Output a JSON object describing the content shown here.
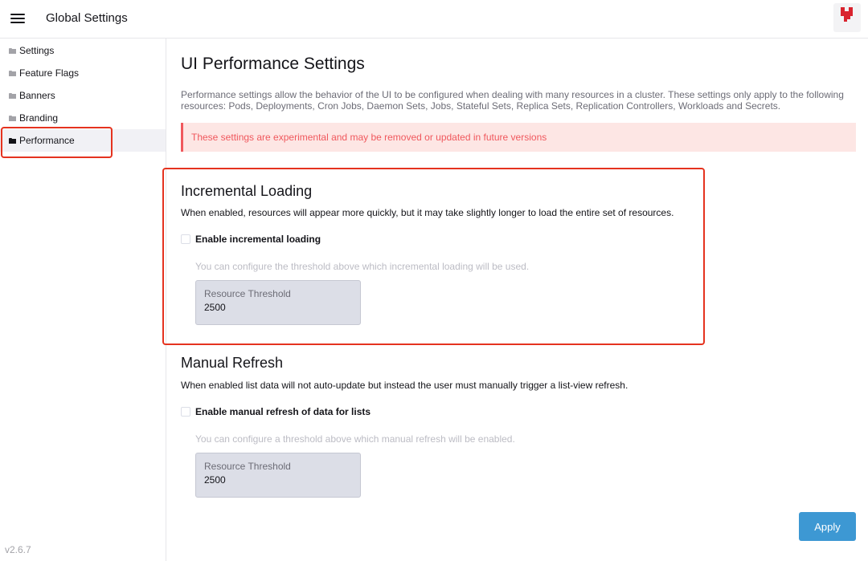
{
  "header": {
    "title": "Global Settings",
    "menu_icon": "hamburger-icon",
    "avatar_icon": "brand-logo-icon"
  },
  "sidebar": {
    "items": [
      {
        "label": "Settings",
        "icon": "folder-icon",
        "active": false
      },
      {
        "label": "Feature Flags",
        "icon": "folder-icon",
        "active": false
      },
      {
        "label": "Banners",
        "icon": "folder-icon",
        "active": false
      },
      {
        "label": "Branding",
        "icon": "folder-icon",
        "active": false
      },
      {
        "label": "Performance",
        "icon": "folder-icon",
        "active": true
      }
    ],
    "version": "v2.6.7"
  },
  "main": {
    "title": "UI Performance Settings",
    "description": "Performance settings allow the behavior of the UI to be configured when dealing with many resources in a cluster. These settings only apply to the following resources: Pods, Deployments, Cron Jobs, Daemon Sets, Jobs, Stateful Sets, Replica Sets, Replication Controllers, Workloads and Secrets.",
    "warning": "These settings are experimental and may be removed or updated in future versions",
    "incremental": {
      "title": "Incremental Loading",
      "description": "When enabled, resources will appear more quickly, but it may take slightly longer to load the entire set of resources.",
      "checkbox_label": "Enable incremental loading",
      "checked": false,
      "hint": "You can configure the threshold above which incremental loading will be used.",
      "threshold_label": "Resource Threshold",
      "threshold_value": "2500"
    },
    "manual": {
      "title": "Manual Refresh",
      "description": "When enabled list data will not auto-update but instead the user must manually trigger a list-view refresh.",
      "checkbox_label": "Enable manual refresh of data for lists",
      "checked": false,
      "hint": "You can configure a threshold above which manual refresh will be enabled.",
      "threshold_label": "Resource Threshold",
      "threshold_value": "2500"
    },
    "apply_label": "Apply"
  },
  "colors": {
    "accent": "#3d98d3",
    "warning_text": "#f0585d",
    "warning_bg": "#fde6e4",
    "annotation": "#e5331f"
  }
}
